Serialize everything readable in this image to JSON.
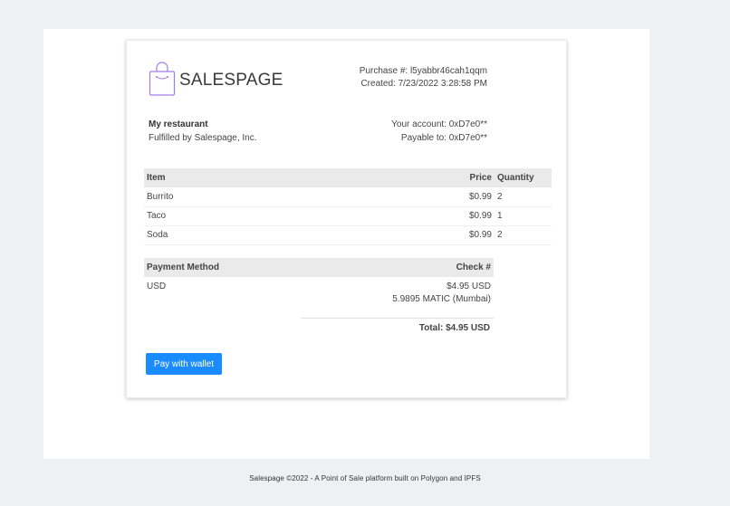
{
  "brand": {
    "name": "SALESPAGE",
    "logo_icon": "shopping-bag-icon",
    "accent": "#a37ae6"
  },
  "purchase": {
    "number_label": "Purchase #: l5yabbr46cah1qqm",
    "created_label": "Created: 7/23/2022 3:28:58 PM"
  },
  "vendor": {
    "name": "My restaurant",
    "fulfilled_by": "Fulfilled by Salespage, Inc."
  },
  "account": {
    "your_account": "Your account: 0xD7e0**",
    "payable_to": "Payable to: 0xD7e0**"
  },
  "items_table": {
    "headers": {
      "item": "Item",
      "price": "Price",
      "quantity": "Quantity"
    },
    "rows": [
      {
        "item": "Burrito",
        "price": "$0.99",
        "quantity": "2"
      },
      {
        "item": "Taco",
        "price": "$0.99",
        "quantity": "1"
      },
      {
        "item": "Soda",
        "price": "$0.99",
        "quantity": "2"
      }
    ]
  },
  "payment_table": {
    "headers": {
      "method": "Payment Method",
      "check": "Check #"
    },
    "method": "USD",
    "amount_usd": "$4.95 USD",
    "amount_matic": "5.9895 MATIC (Mumbai)"
  },
  "total": "Total: $4.95 USD",
  "pay_button": {
    "label": "Pay with wallet",
    "color": "#1a8cff"
  },
  "footer": "Salespage ©2022 - A Point of Sale platform built on Polygon and IPFS"
}
